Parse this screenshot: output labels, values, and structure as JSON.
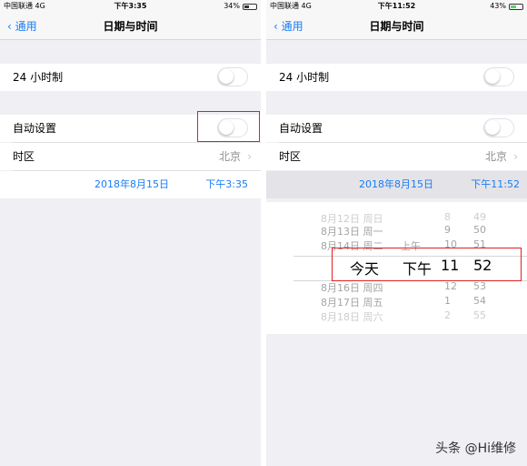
{
  "left": {
    "status": {
      "carrier": "中国联通 4G",
      "time": "下午3:35",
      "battery": "34%"
    },
    "nav": {
      "back": "通用",
      "title": "日期与时间"
    },
    "row24": "24 小时制",
    "auto": "自动设置",
    "tz_label": "时区",
    "tz_value": "北京",
    "date": "2018年8月15日",
    "time": "下午3:35"
  },
  "right": {
    "status": {
      "carrier": "中国联通 4G",
      "time": "下午11:52",
      "battery": "43%"
    },
    "nav": {
      "back": "通用",
      "title": "日期与时间"
    },
    "row24": "24 小时制",
    "auto": "自动设置",
    "tz_label": "时区",
    "tz_value": "北京",
    "date": "2018年8月15日",
    "time": "下午11:52",
    "picker": {
      "rows": [
        {
          "date": "8月12日 周日",
          "ampm": "",
          "hour": "8",
          "min": "49"
        },
        {
          "date": "8月13日 周一",
          "ampm": "",
          "hour": "9",
          "min": "50"
        },
        {
          "date": "8月14日 周二",
          "ampm": "上午",
          "hour": "10",
          "min": "51"
        },
        {
          "date": "今天",
          "ampm": "下午",
          "hour": "11",
          "min": "52"
        },
        {
          "date": "8月16日 周四",
          "ampm": "",
          "hour": "12",
          "min": "53"
        },
        {
          "date": "8月17日 周五",
          "ampm": "",
          "hour": "1",
          "min": "54"
        },
        {
          "date": "8月18日 周六",
          "ampm": "",
          "hour": "2",
          "min": "55"
        }
      ]
    }
  },
  "watermark": "头条 @Hi维修"
}
